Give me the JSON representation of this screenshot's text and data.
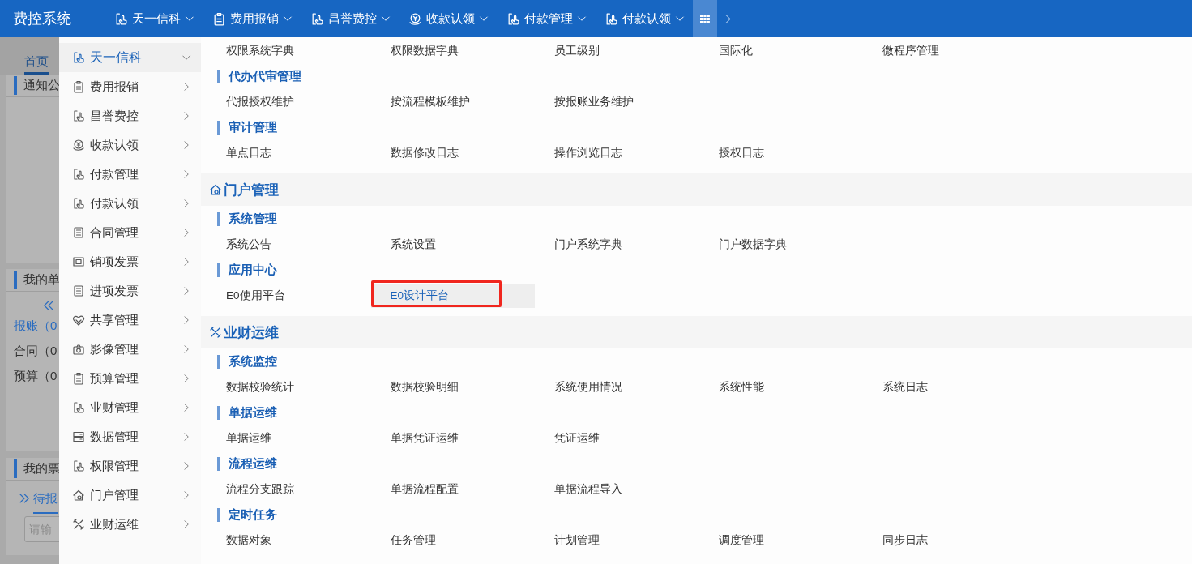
{
  "app_title": "费控系统",
  "top_nav": [
    {
      "label": "天一信科",
      "kind": "hand"
    },
    {
      "label": "费用报销",
      "kind": "clipboard"
    },
    {
      "label": "昌誉费控",
      "kind": "hand"
    },
    {
      "label": "收款认领",
      "kind": "coin"
    },
    {
      "label": "付款管理",
      "kind": "hand"
    },
    {
      "label": "付款认领",
      "kind": "hand"
    }
  ],
  "apps_button": {
    "selected": true
  },
  "background_page": {
    "tab": {
      "label": "首页",
      "selected": true
    },
    "notice_panel": {
      "title": "通知公"
    },
    "documents_panel": {
      "title": "我的单",
      "items": [
        {
          "label": "报账（0",
          "selected": true
        },
        {
          "label": "合同（0",
          "selected": false
        },
        {
          "label": "预算（0",
          "selected": false
        }
      ]
    },
    "invoice_panel": {
      "title": "我的票",
      "tab": "待报",
      "placeholder": "请输"
    }
  },
  "side_menu": [
    {
      "label": "天一信科",
      "kind": "hand",
      "selected": true
    },
    {
      "label": "费用报销",
      "kind": "clipboard",
      "selected": false
    },
    {
      "label": "昌誉费控",
      "kind": "hand",
      "selected": false
    },
    {
      "label": "收款认领",
      "kind": "coin",
      "selected": false
    },
    {
      "label": "付款管理",
      "kind": "hand",
      "selected": false
    },
    {
      "label": "付款认领",
      "kind": "hand",
      "selected": false
    },
    {
      "label": "合同管理",
      "kind": "document",
      "selected": false
    },
    {
      "label": "销项发票",
      "kind": "invoice",
      "selected": false
    },
    {
      "label": "进项发票",
      "kind": "document",
      "selected": false
    },
    {
      "label": "共享管理",
      "kind": "handshake",
      "selected": false
    },
    {
      "label": "影像管理",
      "kind": "camera",
      "selected": false
    },
    {
      "label": "预算管理",
      "kind": "clipboard",
      "selected": false
    },
    {
      "label": "业财管理",
      "kind": "hand",
      "selected": false
    },
    {
      "label": "数据管理",
      "kind": "server",
      "selected": false
    },
    {
      "label": "权限管理",
      "kind": "hand",
      "selected": false
    },
    {
      "label": "门户管理",
      "kind": "house",
      "selected": false
    },
    {
      "label": "业财运维",
      "kind": "tools",
      "selected": false
    }
  ],
  "mega_menu": [
    {
      "groups": [
        {
          "items": [
            {
              "label": "权限系统字典",
              "selected": false,
              "boxed": false
            },
            {
              "label": "权限数据字典",
              "selected": false,
              "boxed": false
            },
            {
              "label": "员工级别",
              "selected": false,
              "boxed": false
            },
            {
              "label": "国际化",
              "selected": false,
              "boxed": false
            },
            {
              "label": "微程序管理",
              "selected": false,
              "boxed": false
            }
          ]
        },
        {
          "title": "代办代审管理",
          "items": [
            {
              "label": "代报授权维护",
              "selected": false,
              "boxed": false
            },
            {
              "label": "按流程模板维护",
              "selected": false,
              "boxed": false
            },
            {
              "label": "按报账业务维护",
              "selected": false,
              "boxed": false
            }
          ]
        },
        {
          "title": "审计管理",
          "items": [
            {
              "label": "单点日志",
              "selected": false,
              "boxed": false
            },
            {
              "label": "数据修改日志",
              "selected": false,
              "boxed": false
            },
            {
              "label": "操作浏览日志",
              "selected": false,
              "boxed": false
            },
            {
              "label": "授权日志",
              "selected": false,
              "boxed": false
            }
          ]
        }
      ]
    },
    {
      "title": "门户管理",
      "kind": "house",
      "groups": [
        {
          "title": "系统管理",
          "items": [
            {
              "label": "系统公告",
              "selected": false,
              "boxed": false
            },
            {
              "label": "系统设置",
              "selected": false,
              "boxed": false
            },
            {
              "label": "门户系统字典",
              "selected": false,
              "boxed": false
            },
            {
              "label": "门户数据字典",
              "selected": false,
              "boxed": false
            }
          ]
        },
        {
          "title": "应用中心",
          "items": [
            {
              "label": "E0使用平台",
              "selected": false,
              "boxed": false
            },
            {
              "label": "E0设计平台",
              "selected": true,
              "boxed": true
            }
          ]
        }
      ]
    },
    {
      "title": "业财运维",
      "kind": "tools",
      "groups": [
        {
          "title": "系统监控",
          "items": [
            {
              "label": "数据校验统计",
              "selected": false,
              "boxed": false
            },
            {
              "label": "数据校验明细",
              "selected": false,
              "boxed": false
            },
            {
              "label": "系统使用情况",
              "selected": false,
              "boxed": false
            },
            {
              "label": "系统性能",
              "selected": false,
              "boxed": false
            },
            {
              "label": "系统日志",
              "selected": false,
              "boxed": false
            }
          ]
        },
        {
          "title": "单据运维",
          "items": [
            {
              "label": "单据运维",
              "selected": false,
              "boxed": false
            },
            {
              "label": "单据凭证运维",
              "selected": false,
              "boxed": false
            },
            {
              "label": "凭证运维",
              "selected": false,
              "boxed": false
            }
          ]
        },
        {
          "title": "流程运维",
          "items": [
            {
              "label": "流程分支跟踪",
              "selected": false,
              "boxed": false
            },
            {
              "label": "单据流程配置",
              "selected": false,
              "boxed": false
            },
            {
              "label": "单据流程导入",
              "selected": false,
              "boxed": false
            }
          ]
        },
        {
          "title": "定时任务",
          "items": [
            {
              "label": "数据对象",
              "selected": false,
              "boxed": false
            },
            {
              "label": "任务管理",
              "selected": false,
              "boxed": false
            },
            {
              "label": "计划管理",
              "selected": false,
              "boxed": false
            },
            {
              "label": "调度管理",
              "selected": false,
              "boxed": false
            },
            {
              "label": "同步日志",
              "selected": false,
              "boxed": false
            }
          ]
        }
      ]
    }
  ]
}
